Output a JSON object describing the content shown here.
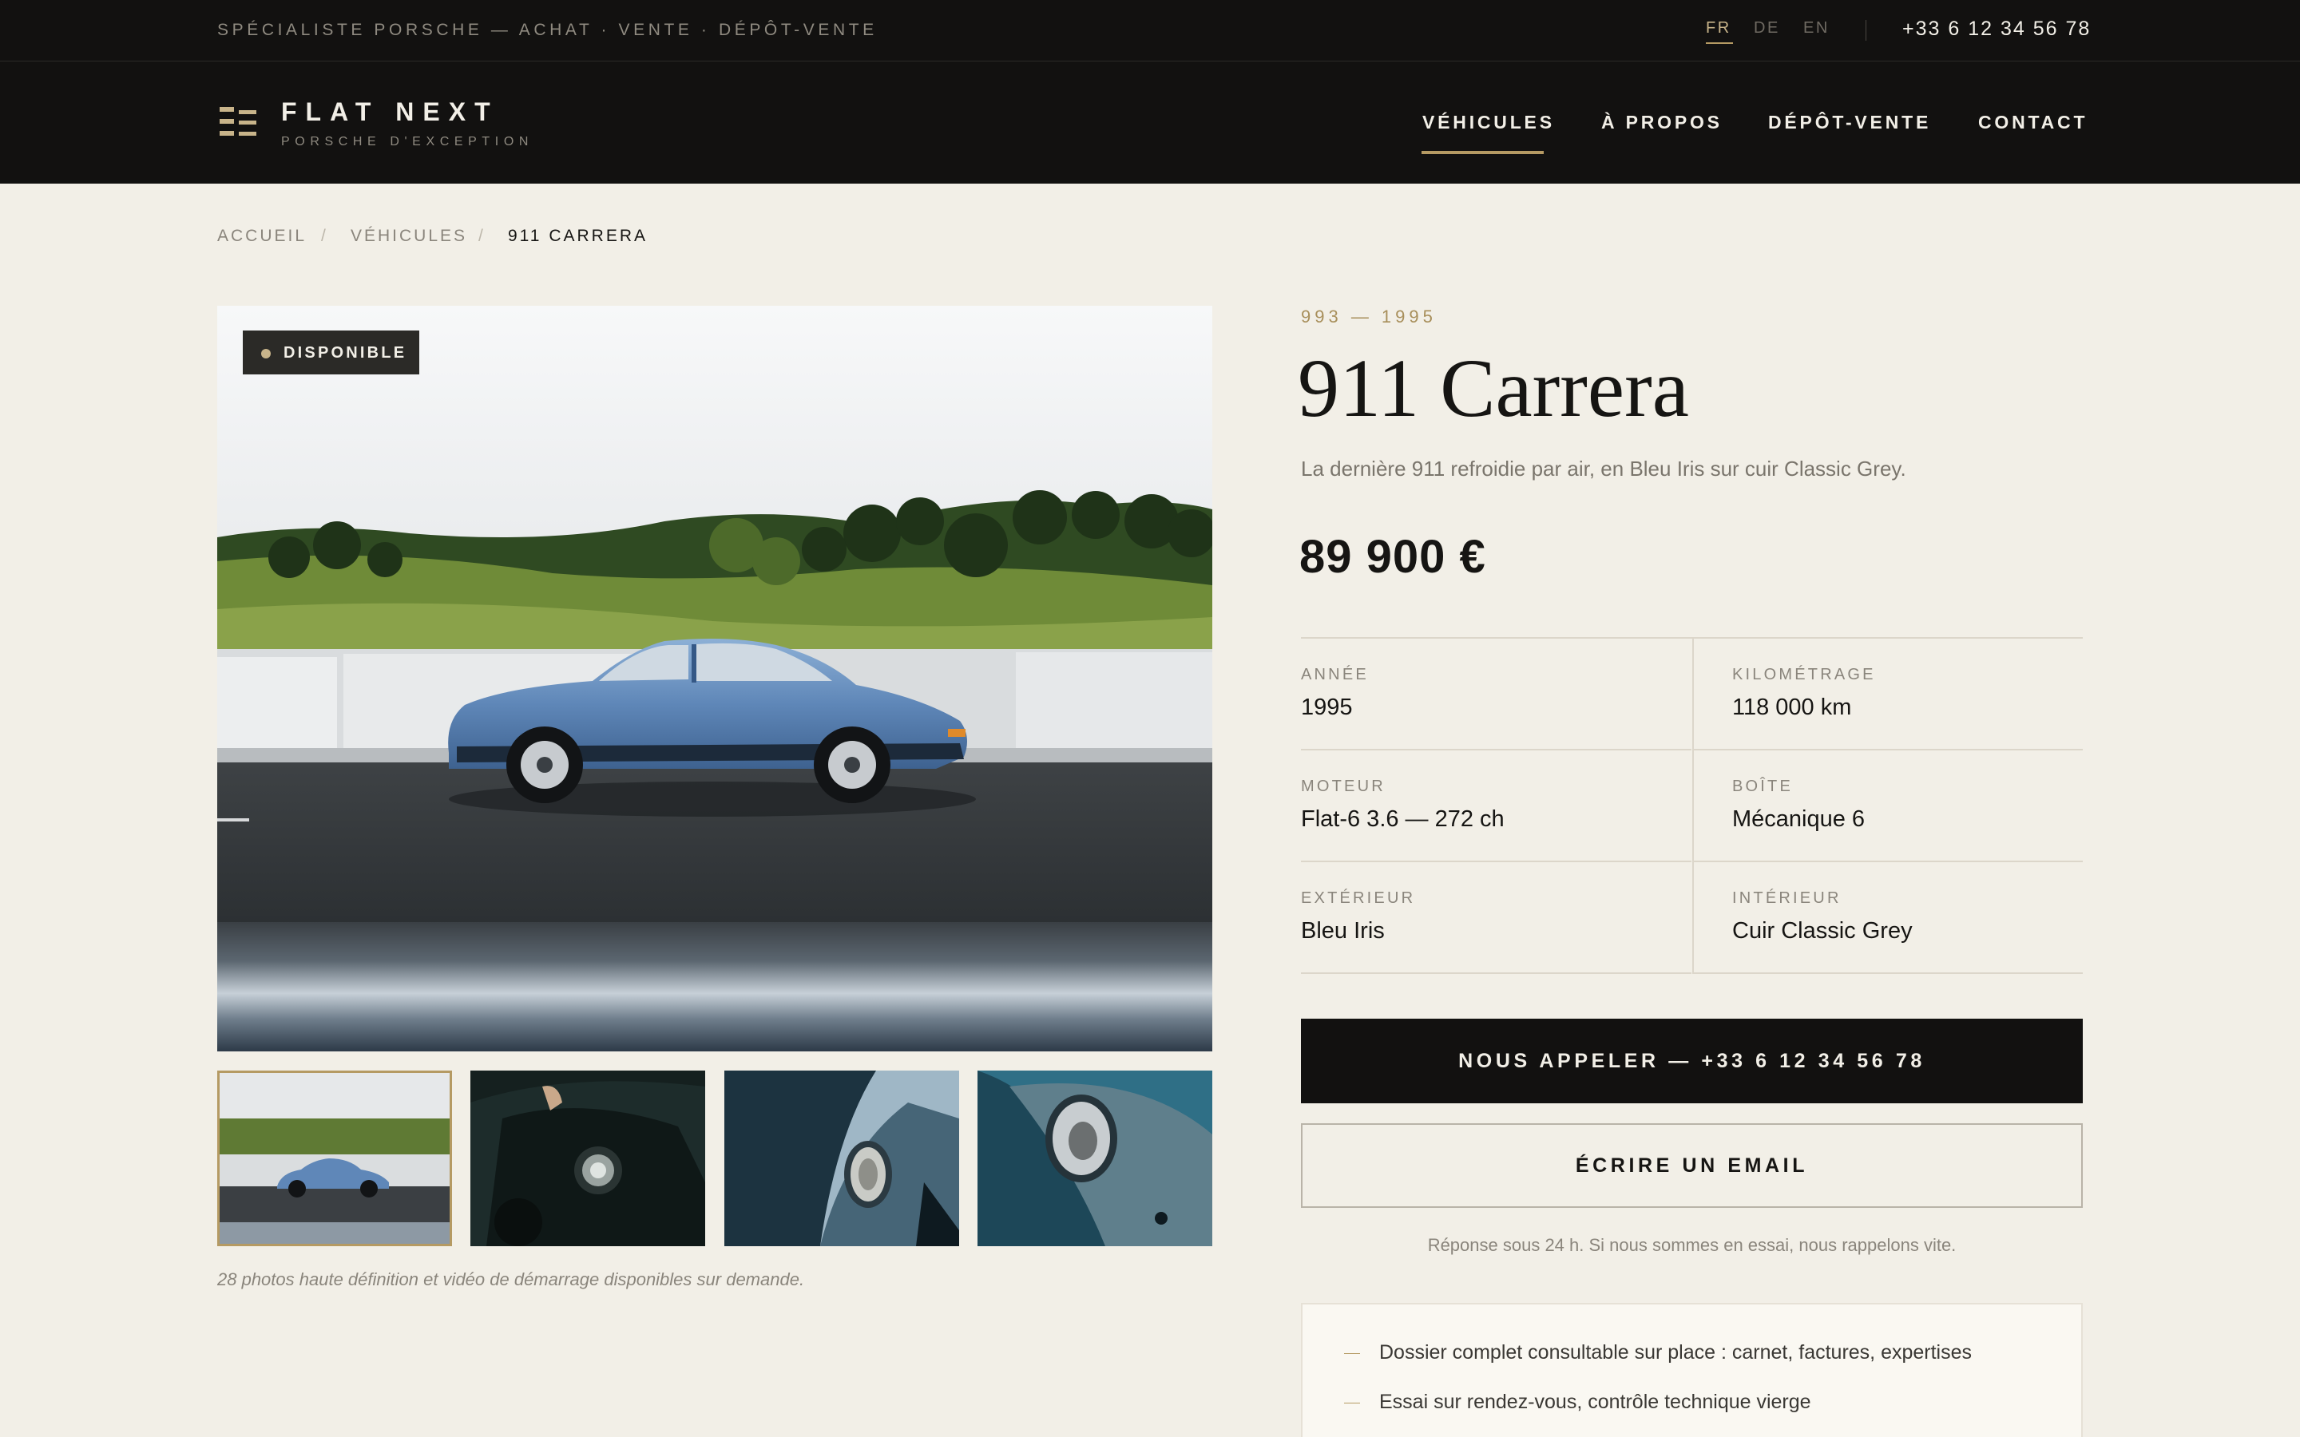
{
  "topbar": {
    "tagline": "SPÉCIALISTE PORSCHE — ACHAT · VENTE · DÉPÔT-VENTE",
    "languages": [
      "FR",
      "DE",
      "EN"
    ],
    "active_language": "FR",
    "phone": "+33 6 12 34 56 78"
  },
  "header": {
    "logo_name": "FLAT NEXT",
    "logo_sub": "PORSCHE D'EXCEPTION",
    "nav": [
      "VÉHICULES",
      "À PROPOS",
      "DÉPÔT-VENTE",
      "CONTACT"
    ],
    "active_nav": "VÉHICULES"
  },
  "breadcrumb": [
    "ACCUEIL",
    "VÉHICULES",
    "911 CARRERA"
  ],
  "gallery": {
    "badge": "DISPONIBLE",
    "thumbnail_count": 4,
    "active_thumbnail": 1,
    "caption": "28 photos haute définition et vidéo de démarrage disponibles sur demande."
  },
  "vehicle": {
    "years": "993 — 1995",
    "title": "911 Carrera",
    "subtitle": "La dernière 911 refroidie par air, en Bleu Iris sur cuir Classic Grey.",
    "price": "89 900 €",
    "specs": [
      {
        "label": "ANNÉE",
        "value": "1995"
      },
      {
        "label": "KILOMÉTRAGE",
        "value": "118 000 km"
      },
      {
        "label": "MOTEUR",
        "value": "Flat-6 3.6 — 272 ch"
      },
      {
        "label": "BOÎTE",
        "value": "Mécanique 6"
      },
      {
        "label": "EXTÉRIEUR",
        "value": "Bleu Iris"
      },
      {
        "label": "INTÉRIEUR",
        "value": "Cuir Classic Grey"
      }
    ]
  },
  "actions": {
    "call_label": "NOUS APPELER — +33 6 12 34 56 78",
    "email_label": "ÉCRIRE UN EMAIL",
    "reply_note": "Réponse sous 24 h. Si nous sommes en essai, nous rappelons vite."
  },
  "perks": [
    "Dossier complet consultable sur place : carnet, factures, expertises",
    "Essai sur rendez-vous, contrôle technique vierge"
  ],
  "colors": {
    "background": "#f2efe7",
    "dark": "#121110",
    "accent_gold": "#b59a63",
    "car_blue": "#5f87b8"
  }
}
